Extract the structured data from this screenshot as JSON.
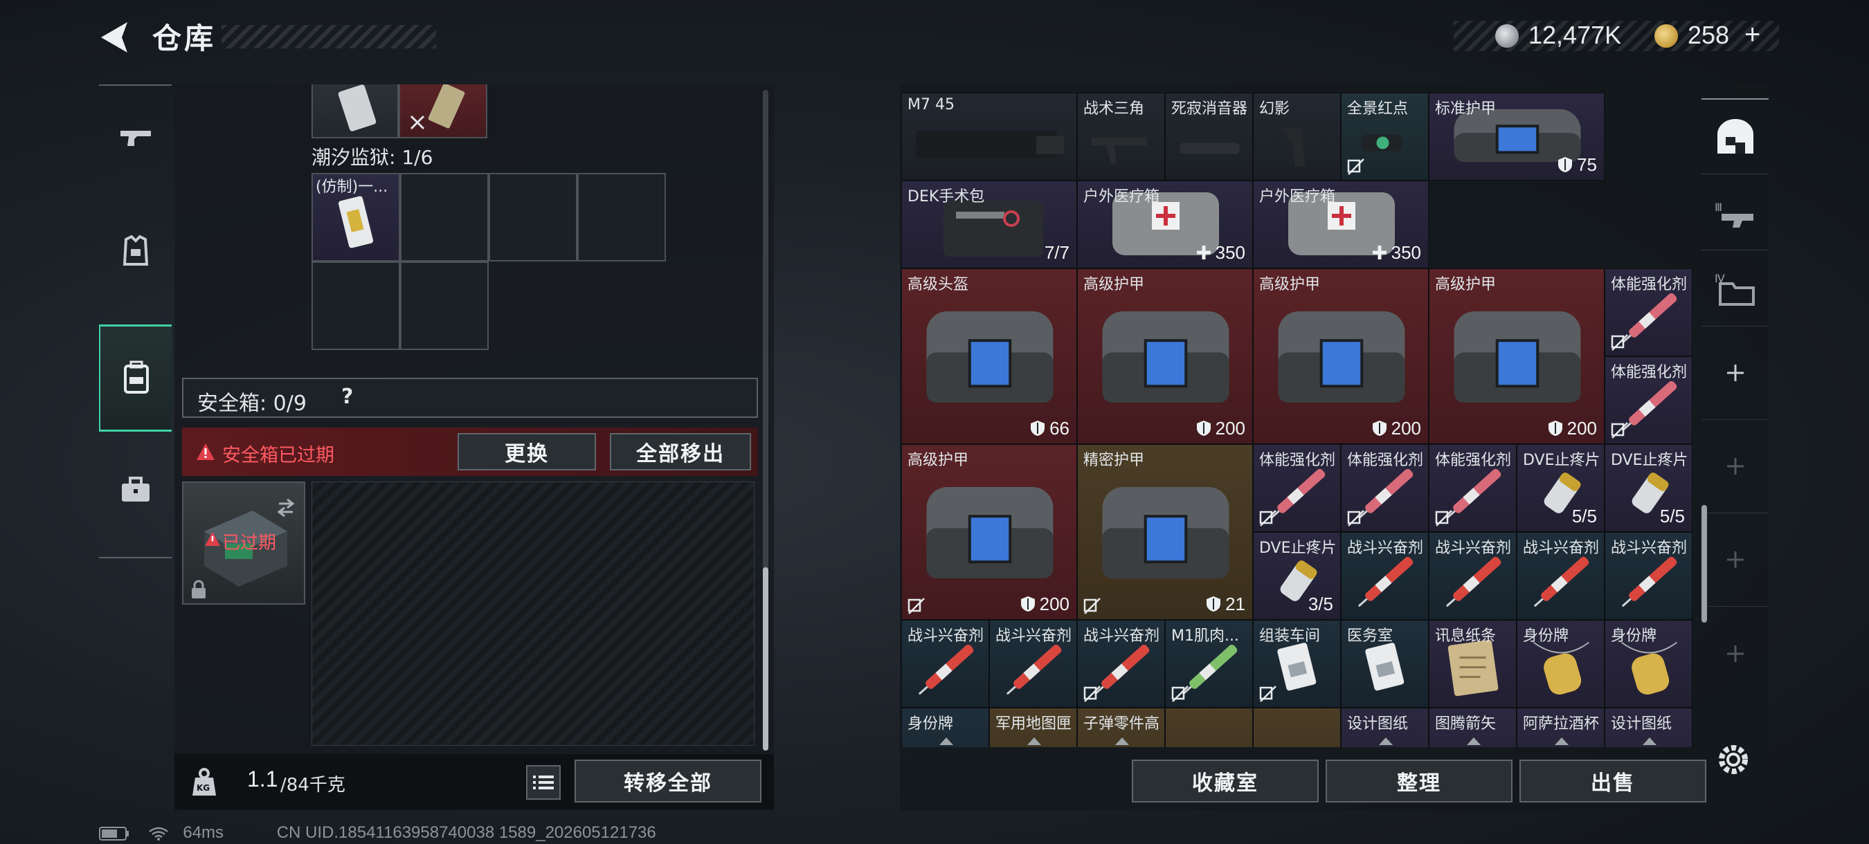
{
  "header": {
    "title": "仓库"
  },
  "currency": {
    "coin1": "12,477K",
    "coin2": "258",
    "add": "+"
  },
  "left": {
    "container_title": "潮汐监狱: 1/6",
    "container_item": "(仿制)一...",
    "safebox_label": "安全箱: 0/9",
    "help": "?",
    "alert_text": "安全箱已过期",
    "replace_btn": "更换",
    "move_out_btn": "全部移出",
    "expired_label": "已过期",
    "weight_value": "1.1",
    "weight_max": "/84千克",
    "kg_icon": "KG",
    "transfer_all_btn": "转移全部"
  },
  "items": [
    {
      "name": "M7 45",
      "value": ""
    },
    {
      "name": "战术三角",
      "value": ""
    },
    {
      "name": "死寂消音器",
      "value": ""
    },
    {
      "name": "幻影",
      "value": ""
    },
    {
      "name": "全景红点",
      "value": ""
    },
    {
      "name": "标准护甲",
      "value": "75"
    },
    {
      "name": "DEK手术包",
      "value": "7/7"
    },
    {
      "name": "户外医疗箱",
      "value": "350"
    },
    {
      "name": "户外医疗箱",
      "value": "350"
    },
    {
      "name": "高级头盔",
      "value": "66"
    },
    {
      "name": "高级护甲",
      "value": "200"
    },
    {
      "name": "高级护甲",
      "value": "200"
    },
    {
      "name": "高级护甲",
      "value": "200"
    },
    {
      "name": "体能强化剂",
      "value": ""
    },
    {
      "name": "体能强化剂",
      "value": ""
    },
    {
      "name": "高级护甲",
      "value": "200"
    },
    {
      "name": "精密护甲",
      "value": "21"
    },
    {
      "name": "体能强化剂",
      "value": ""
    },
    {
      "name": "体能强化剂",
      "value": ""
    },
    {
      "name": "体能强化剂",
      "value": ""
    },
    {
      "name": "DVE止疼片",
      "value": "5/5"
    },
    {
      "name": "DVE止疼片",
      "value": "5/5"
    },
    {
      "name": "DVE止疼片",
      "value": "3/5"
    },
    {
      "name": "战斗兴奋剂",
      "value": ""
    },
    {
      "name": "战斗兴奋剂",
      "value": ""
    },
    {
      "name": "战斗兴奋剂",
      "value": ""
    },
    {
      "name": "战斗兴奋剂",
      "value": ""
    },
    {
      "name": "战斗兴奋剂",
      "value": ""
    },
    {
      "name": "战斗兴奋剂",
      "value": ""
    },
    {
      "name": "战斗兴奋剂",
      "value": ""
    },
    {
      "name": "M1肌肉...",
      "value": ""
    },
    {
      "name": "组装车间",
      "value": ""
    },
    {
      "name": "医务室",
      "value": ""
    },
    {
      "name": "讯息纸条",
      "value": ""
    },
    {
      "name": "身份牌",
      "value": ""
    },
    {
      "name": "身份牌",
      "value": ""
    },
    {
      "name": "身份牌",
      "value": ""
    },
    {
      "name": "军用地图匣",
      "value": ""
    },
    {
      "name": "子弹零件高",
      "value": ""
    },
    {
      "name": "设计图纸",
      "value": ""
    },
    {
      "name": "图腾箭矢",
      "value": ""
    },
    {
      "name": "阿萨拉酒杯",
      "value": ""
    },
    {
      "name": "设计图纸",
      "value": ""
    }
  ],
  "bottom_right": {
    "collection_btn": "收藏室",
    "sort_btn": "整理",
    "sell_btn": "出售"
  },
  "status": {
    "ping": "64ms",
    "uid": "CN UID.18541163958740038 1589_202605121736"
  },
  "colors": {
    "accent_green": "#3fd2a5",
    "alert_red": "#e0404a",
    "blue_rarity": "#1f2f3b",
    "purple_rarity": "#2b2840",
    "red_rarity": "#5a2327",
    "gold_rarity": "#4b3d26"
  }
}
